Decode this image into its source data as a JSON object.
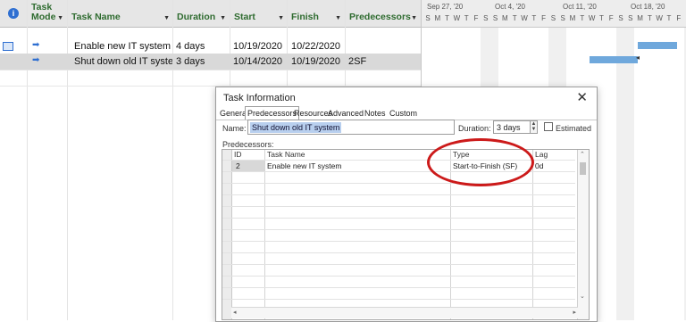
{
  "sheet": {
    "columns": {
      "task_mode": "Task Mode",
      "task_name": "Task Name",
      "duration": "Duration",
      "start": "Start",
      "finish": "Finish",
      "predecessors": "Predecessors"
    },
    "rows": [
      {
        "name": "Enable new IT system",
        "duration": "4 days",
        "start": "10/19/2020",
        "finish": "10/22/2020",
        "predecessors": ""
      },
      {
        "name": "Shut down old IT system",
        "duration": "3 days",
        "start": "10/14/2020",
        "finish": "10/19/2020",
        "predecessors": "2SF"
      }
    ]
  },
  "gantt": {
    "weeks": [
      "Sep 27, '20",
      "Oct 4, '20",
      "Oct 11, '20",
      "Oct 18, '20"
    ],
    "day_letters": "S M T W T F S S M T W T F S S M T W T F S S M T W T F S",
    "bar_color": "#6fa8dc"
  },
  "dialog": {
    "title": "Task Information",
    "tabs": [
      "General",
      "Predecessors",
      "Resources",
      "Advanced",
      "Notes",
      "Custom Fields"
    ],
    "active_tab": "Predecessors",
    "name_label": "Name:",
    "name_value": "Shut down old IT system",
    "duration_label": "Duration:",
    "duration_value": "3 days",
    "estimated_label": "Estimated",
    "estimated_checked": false,
    "predecessors_label": "Predecessors:",
    "grid": {
      "headers": {
        "id": "ID",
        "task_name": "Task Name",
        "type": "Type",
        "lag": "Lag"
      },
      "rows": [
        {
          "id": "2",
          "task_name": "Enable new IT system",
          "type": "Start-to-Finish (SF)",
          "lag": "0d"
        }
      ]
    }
  },
  "annotation": {
    "color": "#cc1a1a"
  }
}
